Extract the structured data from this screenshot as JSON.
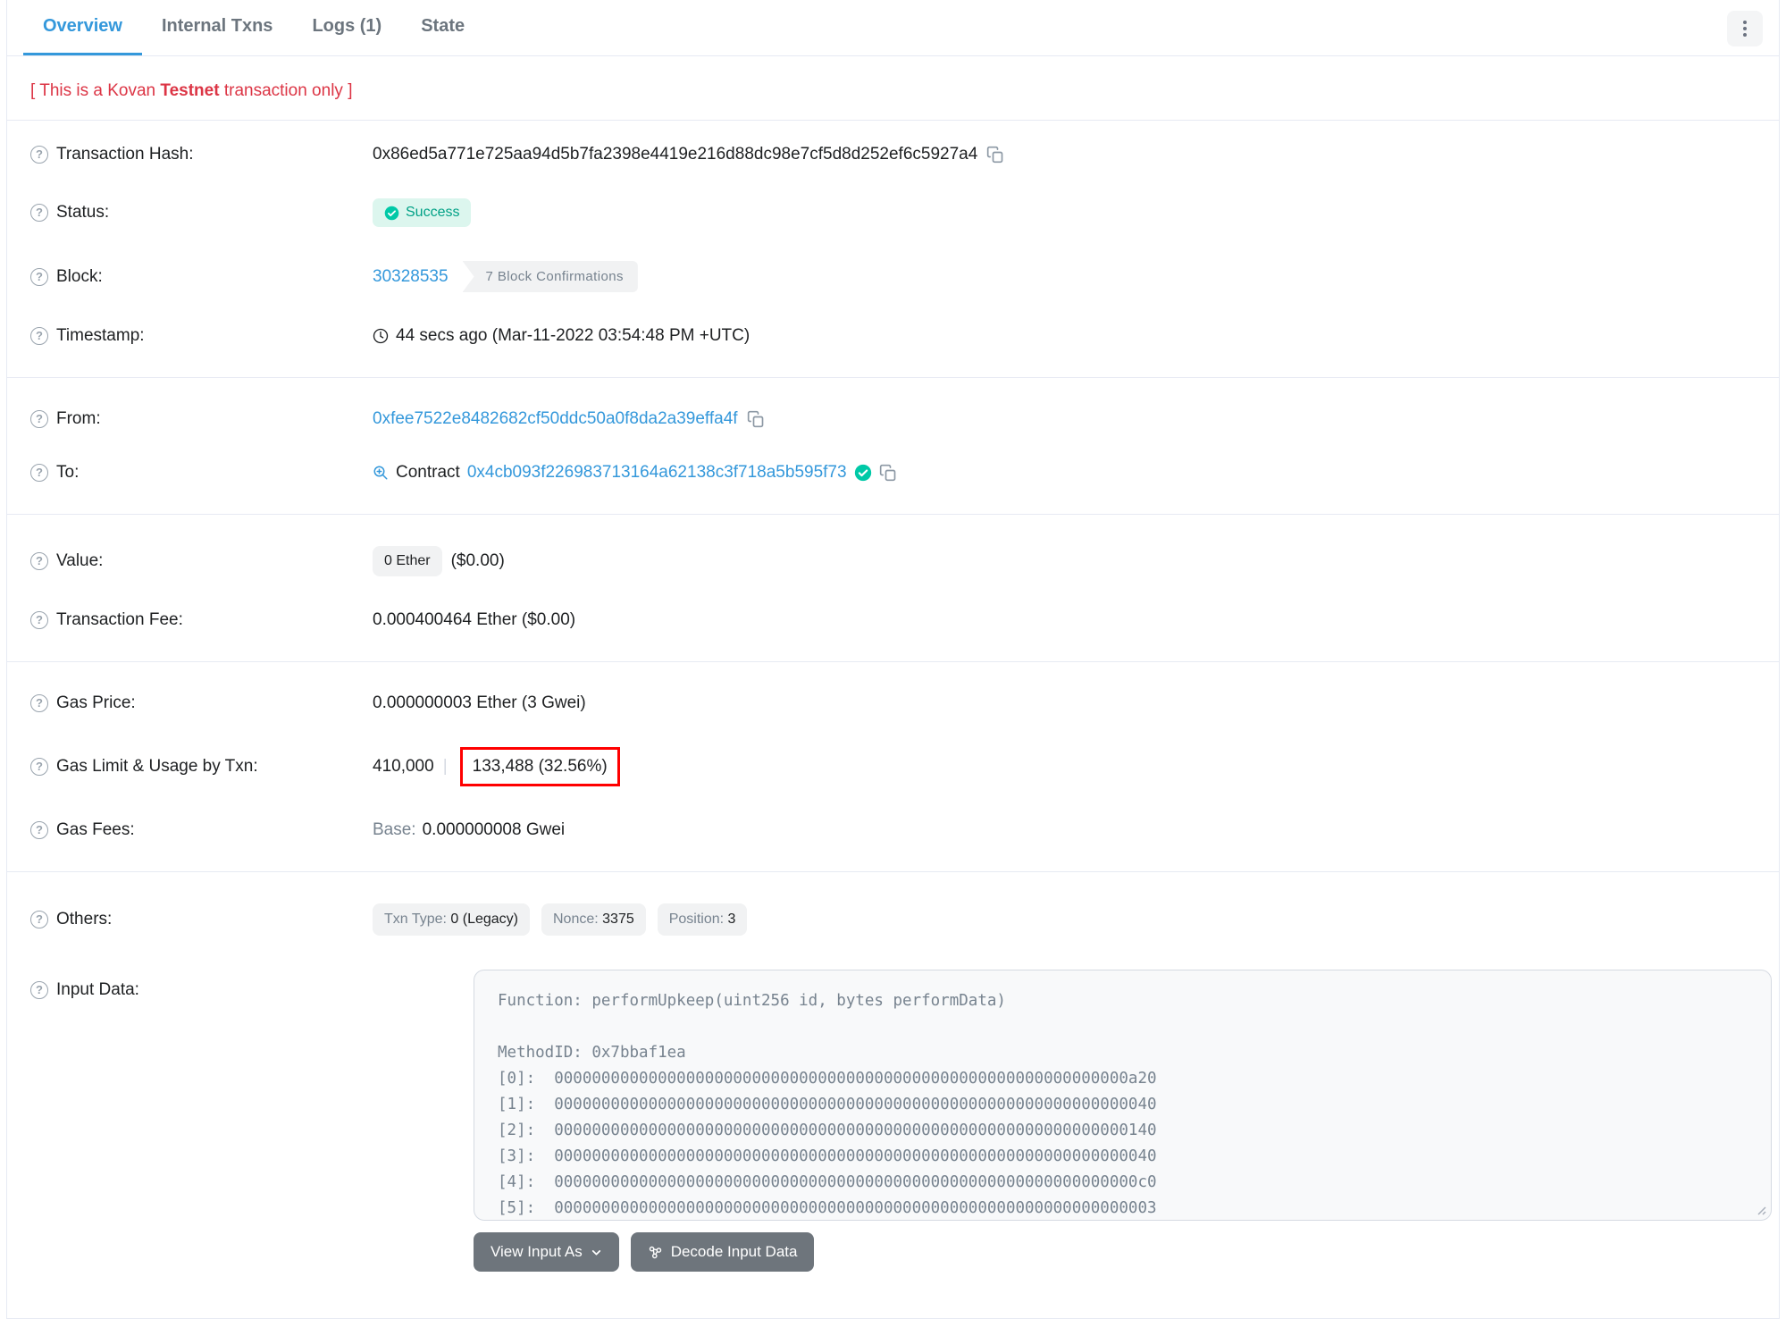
{
  "tabs": {
    "items": [
      {
        "label": "Overview",
        "active": true
      },
      {
        "label": "Internal Txns",
        "active": false
      },
      {
        "label": "Logs (1)",
        "active": false
      },
      {
        "label": "State",
        "active": false
      }
    ]
  },
  "notice": {
    "prefix": "[ This is a Kovan ",
    "bold": "Testnet",
    "suffix": " transaction only ]"
  },
  "rows": {
    "transaction_hash": {
      "label": "Transaction Hash:",
      "value": "0x86ed5a771e725aa94d5b7fa2398e4419e216d88dc98e7cf5d8d252ef6c5927a4"
    },
    "status": {
      "label": "Status:",
      "badge": "Success"
    },
    "block": {
      "label": "Block:",
      "number": "30328535",
      "confirmations": "7 Block Confirmations"
    },
    "timestamp": {
      "label": "Timestamp:",
      "value": "44 secs ago (Mar-11-2022 03:54:48 PM +UTC)"
    },
    "from": {
      "label": "From:",
      "address": "0xfee7522e8482682cf50ddc50a0f8da2a39effa4f"
    },
    "to": {
      "label": "To:",
      "prefix": "Contract",
      "address": "0x4cb093f226983713164a62138c3f718a5b595f73"
    },
    "value": {
      "label": "Value:",
      "badge": "0 Ether",
      "usd": "($0.00)"
    },
    "transaction_fee": {
      "label": "Transaction Fee:",
      "value": "0.000400464 Ether ($0.00)"
    },
    "gas_price": {
      "label": "Gas Price:",
      "value": "0.000000003 Ether (3 Gwei)"
    },
    "gas_limit": {
      "label": "Gas Limit & Usage by Txn:",
      "limit": "410,000",
      "separator": "|",
      "usage": "133,488 (32.56%)"
    },
    "gas_fees": {
      "label": "Gas Fees:",
      "base_label": "Base:",
      "base_value": "0.000000008 Gwei"
    },
    "others": {
      "label": "Others:",
      "badges": [
        {
          "name": "Txn Type: ",
          "value": "0 (Legacy)"
        },
        {
          "name": "Nonce: ",
          "value": "3375"
        },
        {
          "name": "Position: ",
          "value": "3"
        }
      ]
    },
    "input_data": {
      "label": "Input Data:",
      "lines": [
        "Function: performUpkeep(uint256 id, bytes performData)",
        "",
        "MethodID: 0x7bbaf1ea",
        "[0]:  0000000000000000000000000000000000000000000000000000000000000a20",
        "[1]:  0000000000000000000000000000000000000000000000000000000000000040",
        "[2]:  0000000000000000000000000000000000000000000000000000000000000140",
        "[3]:  0000000000000000000000000000000000000000000000000000000000000040",
        "[4]:  00000000000000000000000000000000000000000000000000000000000000c0",
        "[5]:  0000000000000000000000000000000000000000000000000000000000000003"
      ]
    }
  },
  "buttons": {
    "view_input_as": "View Input As",
    "decode_input_data": "Decode Input Data"
  },
  "colors": {
    "accent_blue": "#3498db",
    "success_teal": "#00c9a7",
    "success_text": "#00a186",
    "danger_red": "#dc3545",
    "highlight_box_red": "#ff0000",
    "button_gray": "#6e757c",
    "border_gray": "#e7eaf3"
  }
}
